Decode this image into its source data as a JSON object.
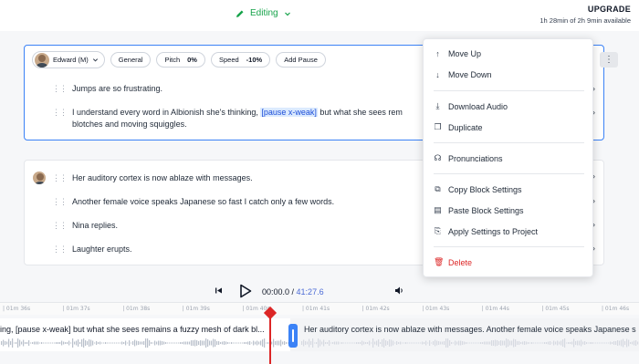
{
  "header": {
    "mode_label": "Editing",
    "upgrade_label": "UPGRADE",
    "quota_text": "1h 28min of 2h 9min available"
  },
  "block1": {
    "voice": "Edward (M)",
    "style": "General",
    "pitch_label": "Pitch",
    "pitch_value": "0%",
    "speed_label": "Speed",
    "speed_value": "-10%",
    "add_pause": "Add Pause",
    "line1": "Jumps are so frustrating.",
    "line2_pre": "I understand every word in Albionish she's thinking, ",
    "line2_tag": "[pause x-weak]",
    "line2_post": " but what she sees rem",
    "line2_wrap": "blotches and moving squiggles."
  },
  "block2": {
    "lines": [
      "Her auditory cortex is now ablaze with messages.",
      "Another female voice speaks Japanese so fast I catch only a few words.",
      "Nina replies.",
      "Laughter erupts."
    ]
  },
  "menu": {
    "move_up": "Move Up",
    "move_down": "Move Down",
    "download_audio": "Download Audio",
    "duplicate": "Duplicate",
    "pronunciations": "Pronunciations",
    "copy_settings": "Copy Block Settings",
    "paste_settings": "Paste Block Settings",
    "apply_settings": "Apply Settings to Project",
    "delete": "Delete"
  },
  "player": {
    "current_time": "00:00.0",
    "separator": " / ",
    "total_time": "41:27.6"
  },
  "timeline": {
    "ticks": [
      "01m 36s",
      "01m 37s",
      "01m 38s",
      "01m 39s",
      "01m 40s",
      "01m 41s",
      "01m 42s",
      "01m 43s",
      "01m 44s",
      "01m 45s",
      "01m 46s"
    ],
    "clip1_text": "ing, [pause x-weak] but what she sees remains a fuzzy mesh of dark bl...",
    "clip2_text": "Her auditory cortex is now ablaze with messages. Another female voice speaks Japanese s"
  },
  "colors": {
    "accent": "#3b82f6",
    "editing": "#16a34a",
    "danger": "#dc2626"
  }
}
